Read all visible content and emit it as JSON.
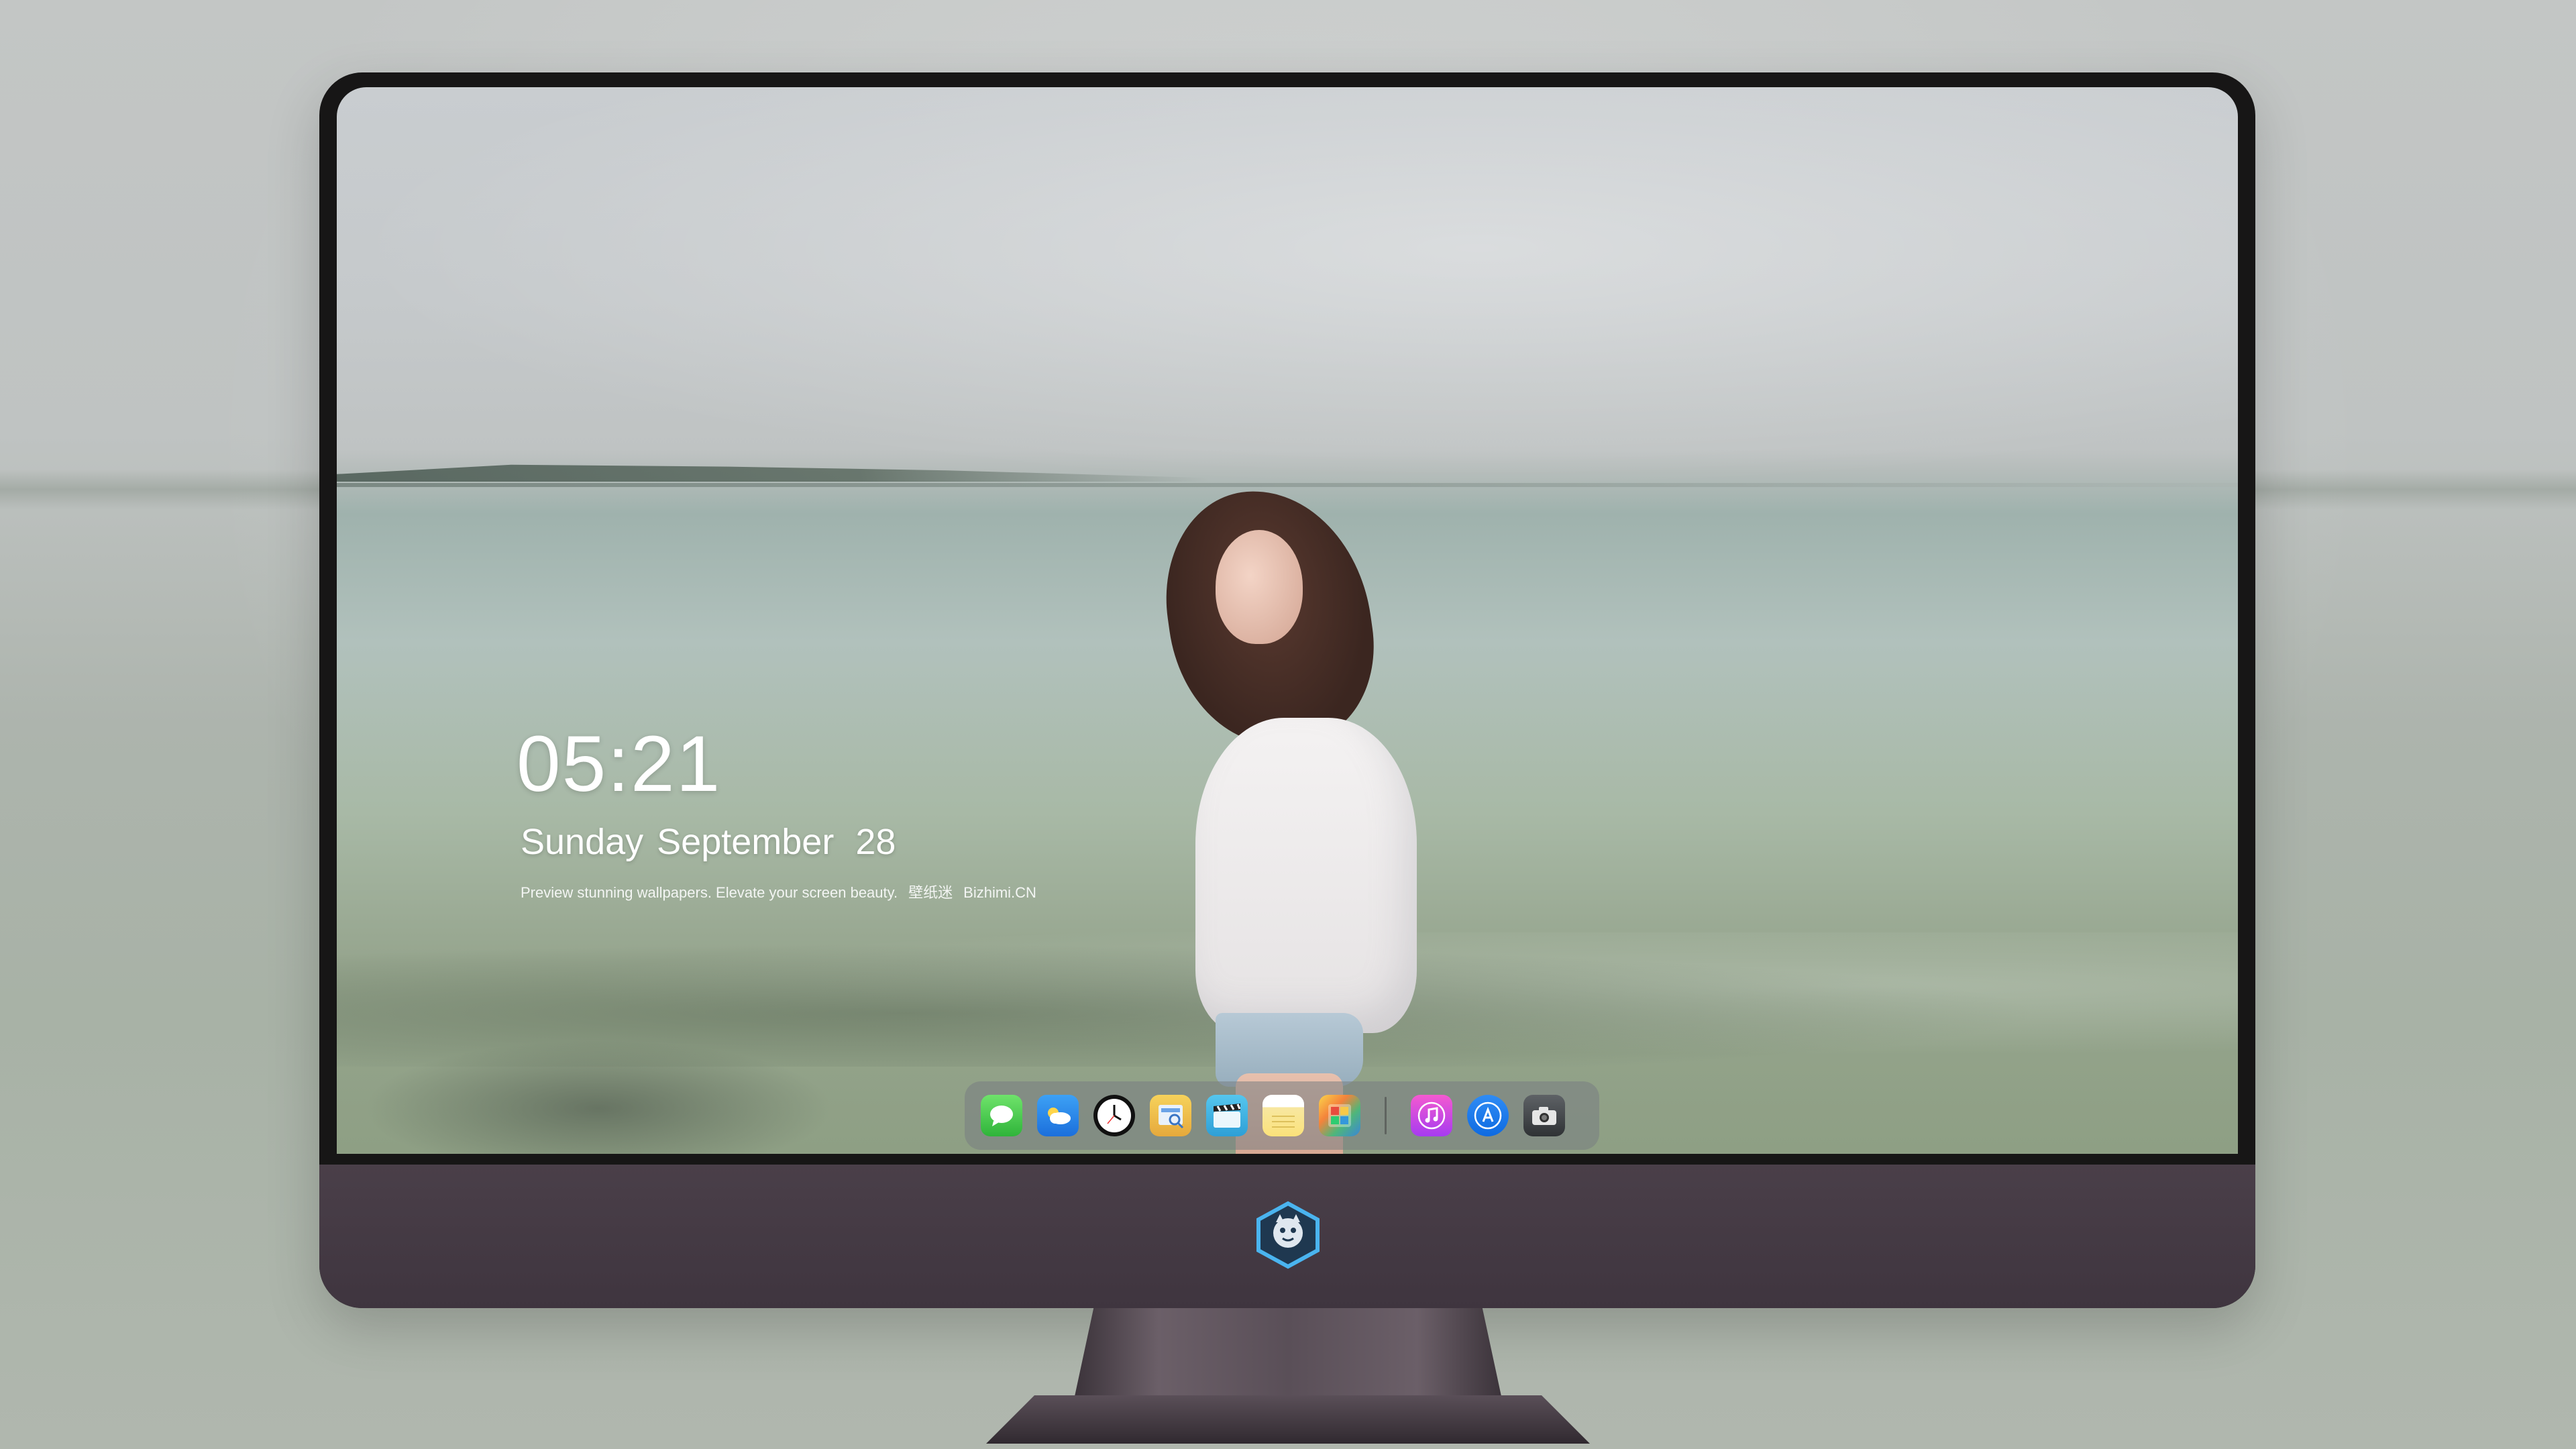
{
  "lockscreen": {
    "time": "05:21",
    "weekday": "Sunday",
    "month": "September",
    "day": "28",
    "tagline_text": "Preview stunning wallpapers. Elevate your screen beauty.",
    "brand_cn": "壁纸迷",
    "brand_site": "Bizhimi.CN"
  },
  "dock": {
    "apps": [
      {
        "name": "Messages",
        "icon": "messages-icon"
      },
      {
        "name": "Weather",
        "icon": "weather-icon"
      },
      {
        "name": "Clock",
        "icon": "clock-icon"
      },
      {
        "name": "Preview",
        "icon": "preview-icon"
      },
      {
        "name": "Clips",
        "icon": "clapperboard-icon"
      },
      {
        "name": "Notes",
        "icon": "notes-icon"
      },
      {
        "name": "Photos",
        "icon": "photos-icon"
      },
      {
        "name": "Music",
        "icon": "music-icon"
      },
      {
        "name": "App Store",
        "icon": "app-store-icon"
      },
      {
        "name": "Camera",
        "icon": "camera-icon"
      }
    ]
  },
  "colors": {
    "bezel": "#171616",
    "chin": "#433841",
    "dock_bg": "#7d8286"
  }
}
